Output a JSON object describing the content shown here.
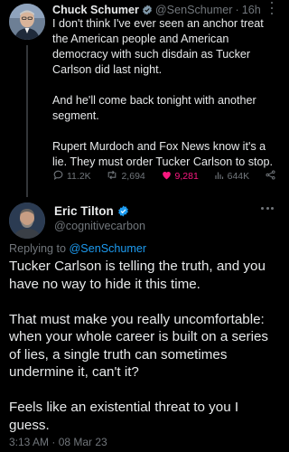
{
  "parent_tweet": {
    "author_name": "Chuck Schumer",
    "handle": "@SenSchumer",
    "separator": "·",
    "time_ago": "16h",
    "paragraphs": [
      "I don't think I've ever seen an anchor treat the American people and American democracy with such disdain as Tucker Carlson did last night.",
      "And he'll come back tonight with another segment.",
      "Rupert Murdoch and Fox News know it's a lie. They must order Tucker Carlson to stop."
    ],
    "stats": {
      "replies": "11.2K",
      "retweets": "2,694",
      "likes": "9,281",
      "views": "644K"
    }
  },
  "reply_tweet": {
    "author_name": "Eric Tilton",
    "handle": "@cognitivecarbon",
    "replying_prefix": "Replying to",
    "replying_to": "@SenSchumer",
    "paragraphs": [
      "Tucker Carlson is telling the truth, and you have no way to hide it this time.",
      "That must make you really uncomfortable: when your whole career is built on a series of lies, a single truth can sometimes undermine it, can't it?",
      "Feels like an existential threat to you I guess."
    ],
    "timestamp": "3:13 AM · 08 Mar 23"
  },
  "colors": {
    "background": "#000000",
    "text": "#e7e9ea",
    "muted": "#71767b",
    "verified_blue": "#1d9bf0",
    "link_blue": "#1d9bf0",
    "like_pink": "#f91880"
  },
  "icons": [
    "verified-badge-icon",
    "more-options-icon",
    "reply-icon",
    "retweet-icon",
    "like-icon",
    "views-icon",
    "share-icon"
  ]
}
